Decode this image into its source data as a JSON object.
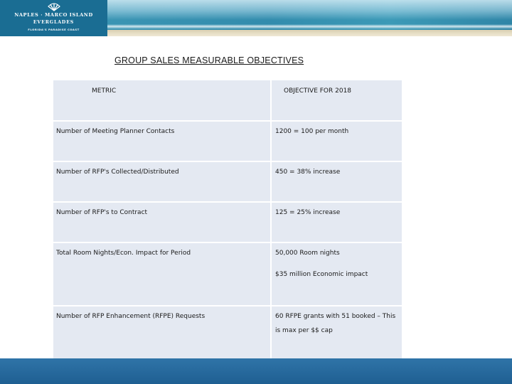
{
  "header": {
    "logo_line1": "NAPLES · MARCO ISLAND",
    "logo_line2": "EVERGLADES",
    "logo_line3": "FLORIDA'S PARADISE COAST",
    "logo_icon": "shell-icon"
  },
  "title": "GROUP SALES MEASURABLE OBJECTIVES",
  "table": {
    "headers": [
      "METRIC",
      "OBJECTIVE FOR 2018"
    ],
    "rows": [
      {
        "metric": "Number of Meeting Planner Contacts",
        "objective": "1200 = 100 per month",
        "objective_line2": ""
      },
      {
        "metric": "Number of RFP's Collected/Distributed",
        "objective": "450 = 38% increase",
        "objective_line2": ""
      },
      {
        "metric": "Number of RFP's to Contract",
        "objective": "125 = 25% increase",
        "objective_line2": ""
      },
      {
        "metric": "Total Room Nights/Econ. Impact for Period",
        "objective": "50,000 Room nights",
        "objective_line2": "$35 million Economic impact"
      },
      {
        "metric": "Number of RFP Enhancement (RFPE) Requests",
        "objective": "60 RFPE grants with 51 booked – This",
        "objective_line2": "is max per $$ cap"
      }
    ]
  },
  "colors": {
    "table_cell": "#e4e9f2",
    "banner_blue": "#1a6d93",
    "footer_blue": "#2f74a8"
  }
}
